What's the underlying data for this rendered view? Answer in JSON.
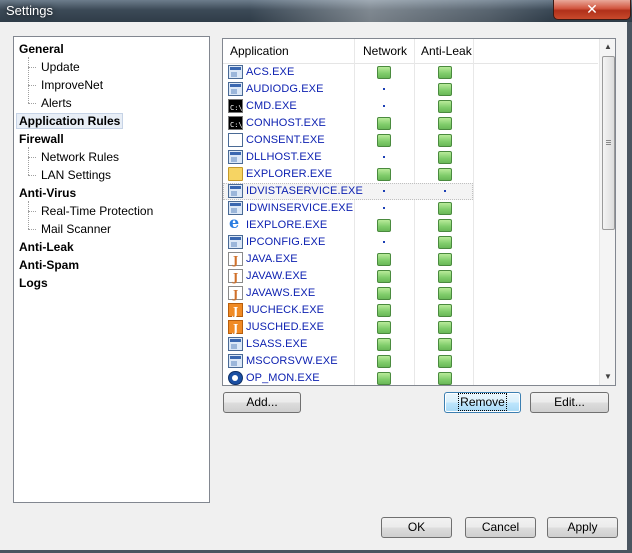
{
  "window": {
    "title": "Settings",
    "close_glyph": "✕"
  },
  "nav": {
    "items": [
      {
        "label": "General",
        "level": 0
      },
      {
        "label": "Update",
        "level": 1
      },
      {
        "label": "ImproveNet",
        "level": 1
      },
      {
        "label": "Alerts",
        "level": 1
      },
      {
        "label": "Application Rules",
        "level": 0,
        "selected": true
      },
      {
        "label": "Firewall",
        "level": 0
      },
      {
        "label": "Network Rules",
        "level": 1
      },
      {
        "label": "LAN Settings",
        "level": 1
      },
      {
        "label": "Anti-Virus",
        "level": 0
      },
      {
        "label": "Real-Time Protection",
        "level": 1
      },
      {
        "label": "Mail Scanner",
        "level": 1
      },
      {
        "label": "Anti-Leak",
        "level": 0
      },
      {
        "label": "Anti-Spam",
        "level": 0
      },
      {
        "label": "Logs",
        "level": 0
      }
    ]
  },
  "apps": {
    "columns": [
      "Application",
      "Network",
      "Anti-Leak"
    ],
    "rows": [
      {
        "name": "ACS.EXE",
        "icon": "window-icon",
        "network": "allow",
        "antileak": "allow"
      },
      {
        "name": "AUDIODG.EXE",
        "icon": "window-icon",
        "network": "none",
        "antileak": "allow"
      },
      {
        "name": "CMD.EXE",
        "icon": "console-icon",
        "network": "none",
        "antileak": "allow"
      },
      {
        "name": "CONHOST.EXE",
        "icon": "console-icon",
        "network": "allow",
        "antileak": "allow"
      },
      {
        "name": "CONSENT.EXE",
        "icon": "blank-window-icon",
        "network": "allow",
        "antileak": "allow"
      },
      {
        "name": "DLLHOST.EXE",
        "icon": "window-icon",
        "network": "none",
        "antileak": "allow"
      },
      {
        "name": "EXPLORER.EXE",
        "icon": "folder-icon",
        "network": "allow",
        "antileak": "allow"
      },
      {
        "name": "IDVISTASERVICE.EXE",
        "icon": "window-icon",
        "network": "none",
        "antileak": "none",
        "selected": true
      },
      {
        "name": "IDWINSERVICE.EXE",
        "icon": "window-icon",
        "network": "none",
        "antileak": "allow"
      },
      {
        "name": "IEXPLORE.EXE",
        "icon": "internet-explorer-icon",
        "network": "allow",
        "antileak": "allow"
      },
      {
        "name": "IPCONFIG.EXE",
        "icon": "window-icon",
        "network": "none",
        "antileak": "allow"
      },
      {
        "name": "JAVA.EXE",
        "icon": "java-icon",
        "network": "allow",
        "antileak": "allow"
      },
      {
        "name": "JAVAW.EXE",
        "icon": "java-icon",
        "network": "allow",
        "antileak": "allow"
      },
      {
        "name": "JAVAWS.EXE",
        "icon": "java-icon",
        "network": "allow",
        "antileak": "allow"
      },
      {
        "name": "JUCHECK.EXE",
        "icon": "java-update-icon",
        "network": "allow",
        "antileak": "allow"
      },
      {
        "name": "JUSCHED.EXE",
        "icon": "java-update-icon",
        "network": "allow",
        "antileak": "allow"
      },
      {
        "name": "LSASS.EXE",
        "icon": "window-icon",
        "network": "allow",
        "antileak": "allow"
      },
      {
        "name": "MSCORSVW.EXE",
        "icon": "window-icon",
        "network": "allow",
        "antileak": "allow"
      },
      {
        "name": "OP_MON.EXE",
        "icon": "monitor-icon",
        "network": "allow",
        "antileak": "allow"
      }
    ]
  },
  "buttons": {
    "add": "Add...",
    "remove": "Remove",
    "edit": "Edit...",
    "ok": "OK",
    "cancel": "Cancel",
    "apply": "Apply"
  },
  "colors": {
    "link_text": "#0b1fb0",
    "allow_green": "#7fcc6a"
  }
}
